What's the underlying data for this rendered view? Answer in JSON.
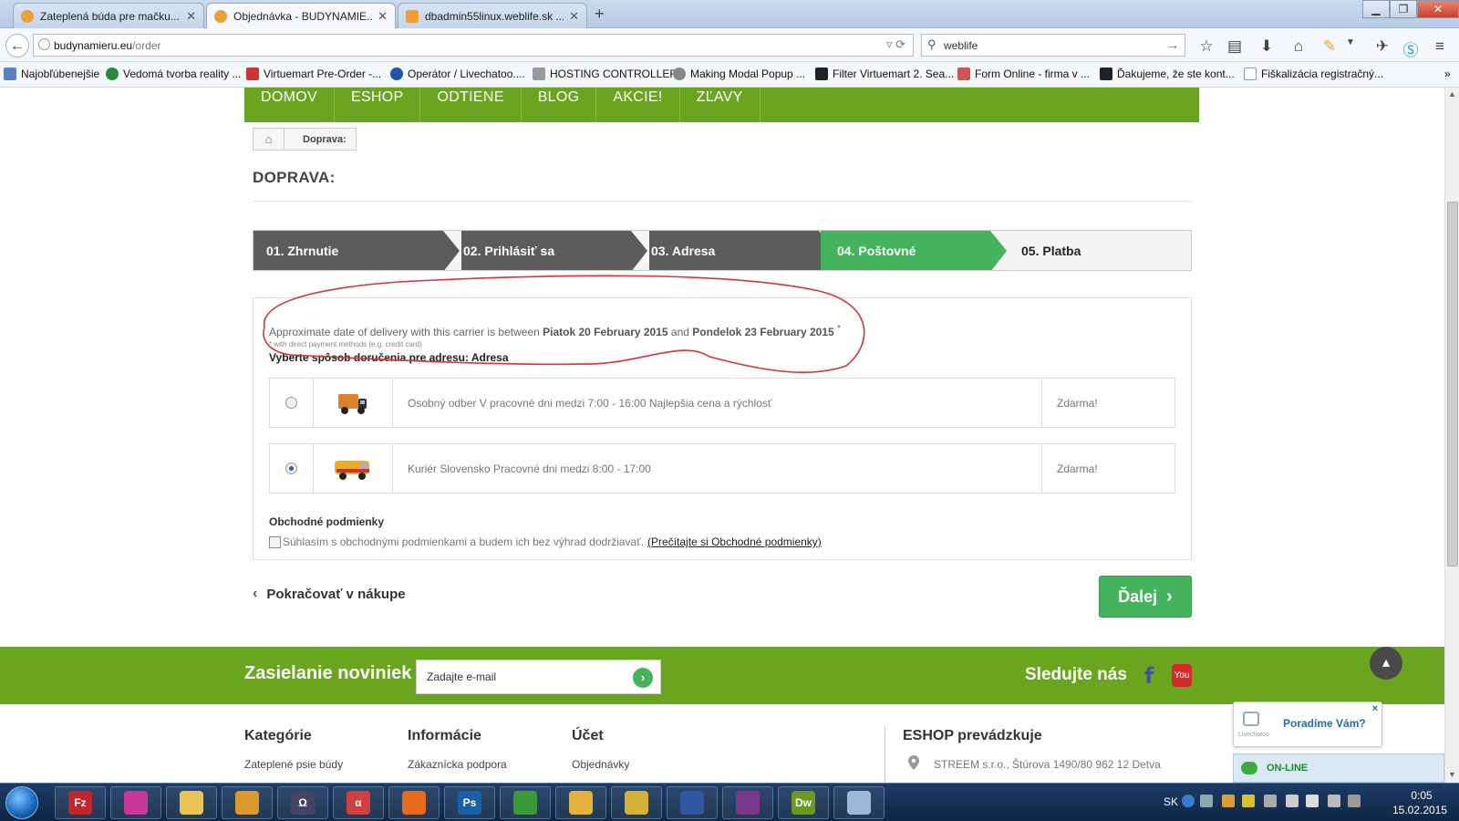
{
  "browser": {
    "tabs": [
      {
        "label": "Zateplená búda pre mačku...",
        "icon_color": "#e8a23a",
        "active": false
      },
      {
        "label": "Objednávka - BUDYNAMIE...",
        "icon_color": "#e8a23a",
        "active": true
      },
      {
        "label": "dbadmin55linux.weblife.sk ...",
        "icon_color": "#f0a030",
        "active": false
      }
    ],
    "new_tab_glyph": "+",
    "url_host": "budynamieru.eu",
    "url_path": "/order",
    "search_value": "weblife",
    "bookmarks": [
      {
        "label": "Najobľúbenejšie",
        "icon_color": "#5b7fbf"
      },
      {
        "label": "Vedomá tvorba reality ...",
        "icon_color": "#2a8a3a"
      },
      {
        "label": "Virtuemart Pre-Order -...",
        "icon_color": "#c33"
      },
      {
        "label": "Operátor / Livechatoo....",
        "icon_color": "#2255aa"
      },
      {
        "label": "HOSTING CONTROLLER",
        "icon_color": "#999"
      },
      {
        "label": "Making Modal Popup ...",
        "icon_color": "#888"
      },
      {
        "label": "Filter Virtuemart 2. Sea...",
        "icon_color": "#222"
      },
      {
        "label": "Form Online - firma v ...",
        "icon_color": "#c55"
      },
      {
        "label": "Ďakujeme, že ste kont...",
        "icon_color": "#222"
      },
      {
        "label": "Fiškalizácia registračný...",
        "icon_color": "#ddd"
      }
    ],
    "overflow_glyph": "»"
  },
  "site": {
    "menu": [
      "DOMOV",
      "ESHOP",
      "ODTIENE",
      "BLOG",
      "AKCIE!",
      "ZĽAVY"
    ],
    "breadcrumb_current": "Doprava:",
    "page_heading": "DOPRAVA:",
    "steps": [
      {
        "label": "01. Zhrnutie",
        "state": "done"
      },
      {
        "label": "02. Prihlásiť sa",
        "state": "done"
      },
      {
        "label": "03. Adresa",
        "state": "done"
      },
      {
        "label": "04. Poštovné",
        "state": "active"
      },
      {
        "label": "05. Platba",
        "state": "future"
      }
    ],
    "delivery": {
      "prefix": "Approximate date of delivery with this carrier is between",
      "date_from": "Piatok 20 February 2015",
      "and": "and",
      "date_to": "Pondelok 23 February 2015",
      "asterisk": "*",
      "payment_note": "* with direct payment methods (e.g. credit card)"
    },
    "choose_title": "Vyberte spôsob doručenia pre adresu: Adresa",
    "options": [
      {
        "description": "Osobný odber V pracovné dni medzi 7:00 - 16:00 Najlepšia cena a rýchlosť",
        "price": "Zdarma!",
        "selected": false,
        "truck_color": "#d9822b"
      },
      {
        "description": "Kuriér Slovensko Pracovné dni medzi 8:00 - 17:00",
        "price": "Zdarma!",
        "selected": true,
        "truck_color": "#e8b020"
      }
    ],
    "terms_title": "Obchodné podmienky",
    "terms_text": "Súhlasím s obchodnými podmienkami a budem ich bez výhrad dodržiavať.",
    "terms_link": "(Prečítajte si Obchodné podmienky)",
    "continue_label": "Pokračovať v nákupe",
    "next_label": "Ďalej",
    "newsletter_title": "Zasielanie noviniek",
    "newsletter_placeholder": "Zadajte e-mail",
    "follow_label": "Sledujte nás",
    "facebook_glyph": "f",
    "youtube_glyph": "You",
    "footer": [
      {
        "title": "Kategórie",
        "link": "Zateplené psie búdy"
      },
      {
        "title": "Informácie",
        "link": "Zákaznícka podpora"
      },
      {
        "title": "Účet",
        "link": "Objednávky"
      }
    ],
    "operator_title": "ESHOP prevádzkuje",
    "operator_address": "STREEM s.r.o., Štúrova 1490/80 962 12 Detva",
    "annotation_color": "#d9323a"
  },
  "chat": {
    "ask_label": "Poradíme Vám?",
    "ask_sub": "Livechatoo",
    "close_glyph": "×",
    "online_label": "ON-LINE"
  },
  "taskbar": {
    "apps": [
      {
        "name": "filezilla",
        "color": "#c0262d",
        "glyph": "Fz"
      },
      {
        "name": "app-2",
        "color": "#c8389a",
        "glyph": ""
      },
      {
        "name": "explorer",
        "color": "#e6c456",
        "glyph": ""
      },
      {
        "name": "pencil",
        "color": "#d89a2a",
        "glyph": ""
      },
      {
        "name": "omega",
        "color": "#444466",
        "glyph": "Ω"
      },
      {
        "name": "app-6",
        "color": "#d04040",
        "glyph": "α"
      },
      {
        "name": "firefox",
        "color": "#e86a1c",
        "glyph": ""
      },
      {
        "name": "photoshop",
        "color": "#1b5fa8",
        "glyph": "Ps"
      },
      {
        "name": "chrome",
        "color": "#3a9a3a",
        "glyph": ""
      },
      {
        "name": "app-9",
        "color": "#e2b23a",
        "glyph": ""
      },
      {
        "name": "app-10",
        "color": "#d2b23a",
        "glyph": ""
      },
      {
        "name": "app-11",
        "color": "#3058a0",
        "glyph": ""
      },
      {
        "name": "winrar",
        "color": "#7a3a8a",
        "glyph": ""
      },
      {
        "name": "dreamweaver",
        "color": "#6a9a22",
        "glyph": "Dw"
      },
      {
        "name": "app-14",
        "color": "#9ab8d8",
        "glyph": ""
      }
    ],
    "language": "SK",
    "time": "0:05",
    "date": "15.02.2015"
  }
}
